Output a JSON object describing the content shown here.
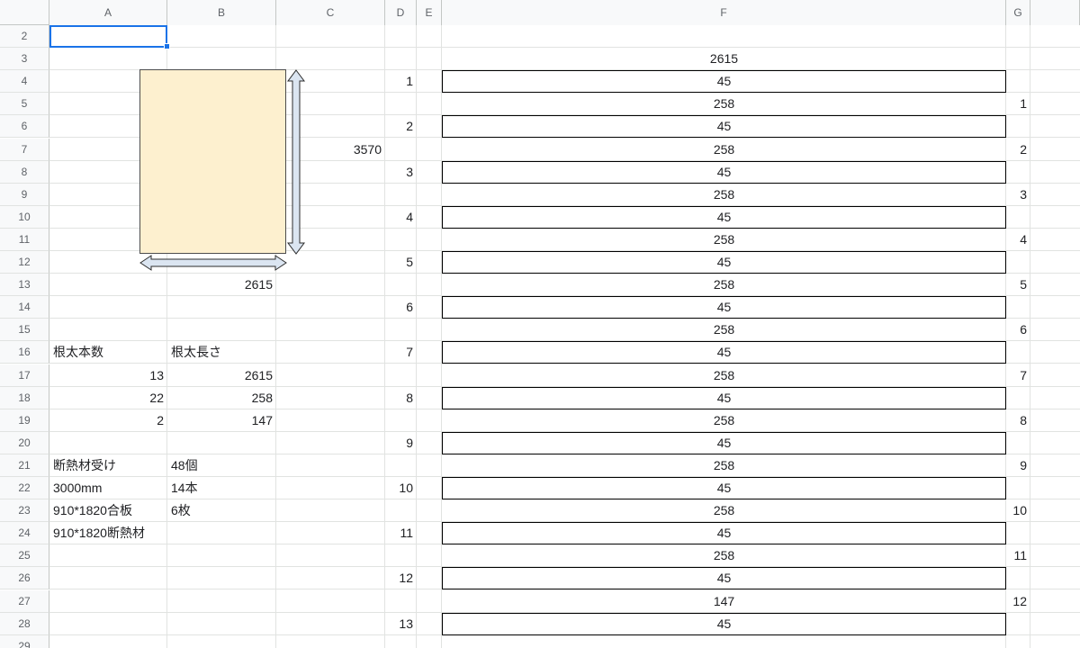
{
  "columns": [
    "A",
    "B",
    "C",
    "D",
    "E",
    "F",
    "G"
  ],
  "rows": [
    2,
    3,
    4,
    5,
    6,
    7,
    8,
    9,
    10,
    11,
    12,
    13,
    14,
    15,
    16,
    17,
    18,
    19,
    20,
    21,
    22,
    23,
    24,
    25,
    26,
    27,
    28,
    29
  ],
  "labels": {
    "width_value": "2615",
    "height_value": "3570",
    "f_header_value": "2615"
  },
  "table": {
    "header": [
      "根太本数",
      "根太長さ"
    ],
    "rows": [
      [
        "13",
        "2615"
      ],
      [
        "22",
        "258"
      ],
      [
        "2",
        "147"
      ]
    ]
  },
  "materials": [
    [
      "断熱材受け",
      "48個"
    ],
    [
      "3000mm",
      "14本"
    ],
    [
      "910*1820合板",
      "6枚"
    ],
    [
      "910*1820断熱材",
      ""
    ]
  ],
  "d_numbers": [
    "1",
    "2",
    "3",
    "4",
    "5",
    "6",
    "7",
    "8",
    "9",
    "10",
    "11",
    "12",
    "13"
  ],
  "f_values": [
    "45",
    "258",
    "45",
    "258",
    "45",
    "258",
    "45",
    "258",
    "45",
    "258",
    "45",
    "258",
    "45",
    "258",
    "45",
    "258",
    "45",
    "258",
    "45",
    "258",
    "45",
    "258",
    "45",
    "147",
    "45"
  ],
  "g_numbers": [
    "1",
    "2",
    "3",
    "4",
    "5",
    "6",
    "7",
    "8",
    "9",
    "10",
    "11",
    "12"
  ],
  "colors": {
    "shape_fill": "#fdf0cf",
    "arrow_fill": "#dbe5f1",
    "selection": "#1a73e8"
  }
}
